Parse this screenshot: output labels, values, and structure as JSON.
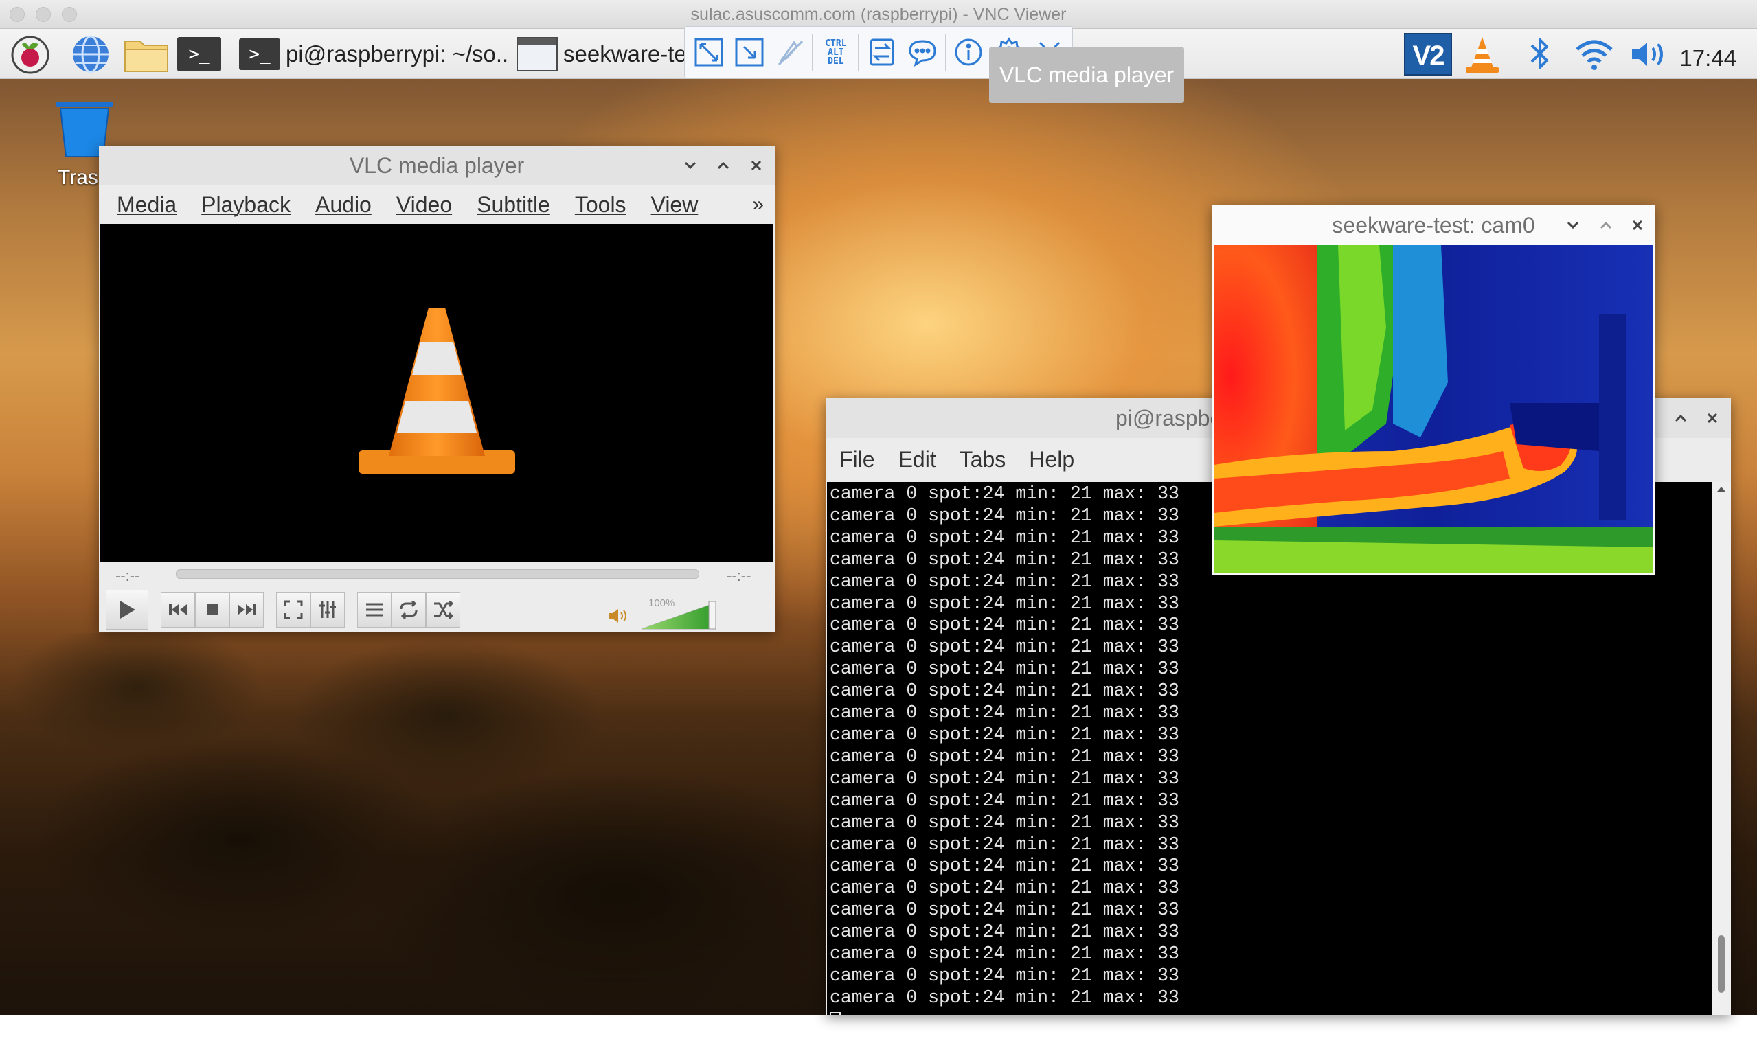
{
  "vnc": {
    "window_title": "sulac.asuscomm.com (raspberrypi) - VNC Viewer",
    "tooltip": "VLC media player",
    "toolbar_icons": [
      "fullscreen-icon",
      "scale-icon",
      "pointer-icon",
      "ctrl-alt-del-icon",
      "file-transfer-icon",
      "chat-icon",
      "info-icon",
      "settings-icon",
      "close-icon"
    ],
    "cad": [
      "CTRL",
      "ALT",
      "DEL"
    ]
  },
  "taskbar": {
    "tasks": [
      {
        "label": "pi@raspberrypi: ~/so...",
        "icon": "terminal-icon"
      },
      {
        "label": "seekware-test",
        "icon": "window-icon"
      }
    ],
    "terminal_glyph": ">_",
    "tray_icon_badge": "V2",
    "clock": "17:44"
  },
  "desktop": {
    "trash_label": "Tras"
  },
  "vlc": {
    "title": "VLC media player",
    "menu": [
      "Media",
      "Playback",
      "Audio",
      "Video",
      "Subtitle",
      "Tools",
      "View"
    ],
    "more": "»",
    "time_elapsed": "--:--",
    "time_total": "--:--",
    "volume_label": "100%",
    "volume_level": 1.0
  },
  "terminal": {
    "title": "pi@raspberrypi: ~",
    "menu": [
      "File",
      "Edit",
      "Tabs",
      "Help"
    ],
    "lines": [
      "camera 0 spot:24 min: 21 max: 33",
      "camera 0 spot:24 min: 21 max: 33",
      "camera 0 spot:24 min: 21 max: 33",
      "camera 0 spot:24 min: 21 max: 33",
      "camera 0 spot:24 min: 21 max: 33",
      "camera 0 spot:24 min: 21 max: 33",
      "camera 0 spot:24 min: 21 max: 33",
      "camera 0 spot:24 min: 21 max: 33",
      "camera 0 spot:24 min: 21 max: 33",
      "camera 0 spot:24 min: 21 max: 33",
      "camera 0 spot:24 min: 21 max: 33",
      "camera 0 spot:24 min: 21 max: 33",
      "camera 0 spot:24 min: 21 max: 33",
      "camera 0 spot:24 min: 21 max: 33",
      "camera 0 spot:24 min: 21 max: 33",
      "camera 0 spot:24 min: 21 max: 33",
      "camera 0 spot:24 min: 21 max: 33",
      "camera 0 spot:24 min: 21 max: 33",
      "camera 0 spot:24 min: 21 max: 33",
      "camera 0 spot:24 min: 21 max: 33",
      "camera 0 spot:24 min: 21 max: 33",
      "camera 0 spot:24 min: 21 max: 33",
      "camera 0 spot:24 min: 21 max: 33",
      "camera 0 spot:24 min: 21 max: 33"
    ]
  },
  "seekware": {
    "title": "seekware-test: cam0"
  },
  "colors": {
    "vlc_orange": "#f28a1c",
    "vnc_blue": "#2e7bd6",
    "terminal_bg": "#000000"
  }
}
